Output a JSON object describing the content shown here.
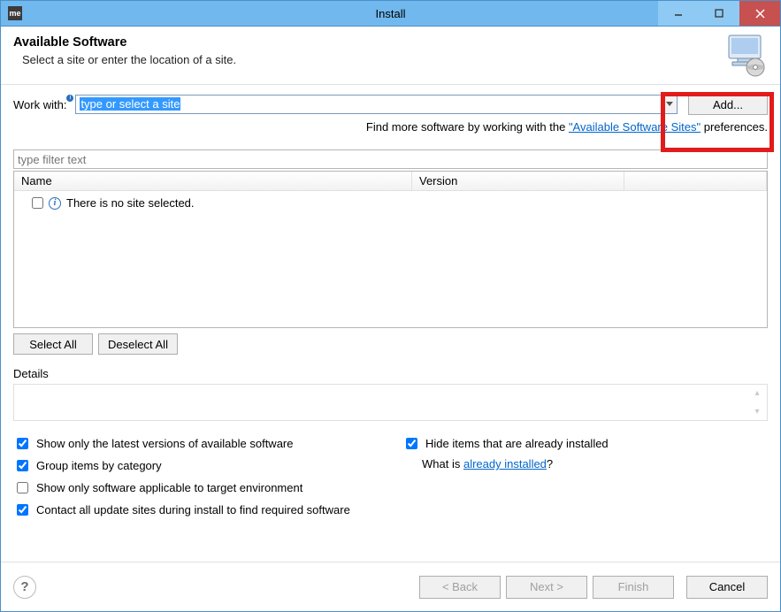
{
  "window": {
    "title": "Install",
    "app_icon_text": "me"
  },
  "header": {
    "title": "Available Software",
    "subtitle": "Select a site or enter the location of a site."
  },
  "work_with": {
    "label": "Work with:",
    "placeholder": "type or select a site",
    "add_button": "Add..."
  },
  "hint": {
    "prefix": "Find more software by working with the ",
    "link": "\"Available Software Sites\"",
    "suffix": " preferences."
  },
  "filter": {
    "placeholder": "type filter text"
  },
  "table": {
    "columns": {
      "name": "Name",
      "version": "Version"
    },
    "empty_message": "There is no site selected."
  },
  "selection_buttons": {
    "select_all": "Select All",
    "deselect_all": "Deselect All"
  },
  "details": {
    "label": "Details"
  },
  "options": {
    "show_latest": {
      "label": "Show only the latest versions of available software",
      "checked": true
    },
    "group_category": {
      "label": "Group items by category",
      "checked": true
    },
    "target_env": {
      "label": "Show only software applicable to target environment",
      "checked": false
    },
    "contact_sites": {
      "label": "Contact all update sites during install to find required software",
      "checked": true
    },
    "hide_installed": {
      "label": "Hide items that are already installed",
      "checked": true
    },
    "what_is_prefix": "What is ",
    "what_is_link": "already installed",
    "what_is_suffix": "?"
  },
  "footer": {
    "back": "< Back",
    "next": "Next >",
    "finish": "Finish",
    "cancel": "Cancel"
  }
}
